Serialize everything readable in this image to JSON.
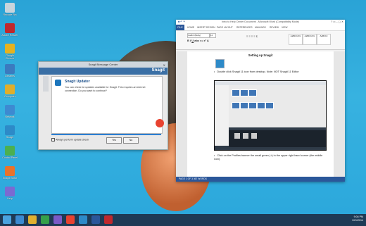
{
  "desktop": {
    "icons": [
      {
        "label": "Recycle Bin",
        "color": "#c8d4dc"
      },
      {
        "label": "Adobe Reader",
        "color": "#c0282d"
      },
      {
        "label": "Google Chrome",
        "color": "#e6b21f"
      },
      {
        "label": "Libraries",
        "color": "#3b7bbf"
      },
      {
        "label": "Computer",
        "color": "#dfae2b"
      },
      {
        "label": "Network",
        "color": "#3d8ad1"
      },
      {
        "label": "Snagit",
        "color": "#2d8ac8"
      },
      {
        "label": "Control Panel",
        "color": "#4caf50"
      },
      {
        "label": "Snagit Editor",
        "color": "#e8732b"
      },
      {
        "label": "Help",
        "color": "#7b6ad1"
      }
    ]
  },
  "snagit_dialog": {
    "title": "Snagit Message Center",
    "brand": "Snagit",
    "heading": "Snagit Updater",
    "message": "You can check for updates available for Snagit. This requires an internet connection. Do you want to continue?",
    "progress": 1.0,
    "checkbox_label": "Always perform update check",
    "yes_label": "Yes",
    "no_label": "No"
  },
  "word": {
    "title": "Intro to Help Center Document - Microsoft Word (Compatibility Mode)",
    "tabs": [
      "HOME",
      "INSERT",
      "DESIGN",
      "PAGE LAYOUT",
      "REFERENCES",
      "MAILINGS",
      "REVIEW",
      "VIEW"
    ],
    "file_tab": "FILE",
    "font_name": "Calibri (Body)",
    "font_size": "11",
    "styles": [
      "AaBbCcDc",
      "AaBbCcDc",
      "AaBbCc"
    ],
    "doc_heading": "Setting up Snagit",
    "paragraphs": [
      "Double click Snagit 11 icon from desktop.  Note: NOT Snagit 11 Editor",
      "Click on the Profiles banner the small green (+) in the upper right hand corner (the middle icon)."
    ],
    "status": "PAGE 1 OF 3    367 WORDS"
  },
  "taskbar": {
    "time": "9:04 PM",
    "date": "1/21/2014"
  }
}
